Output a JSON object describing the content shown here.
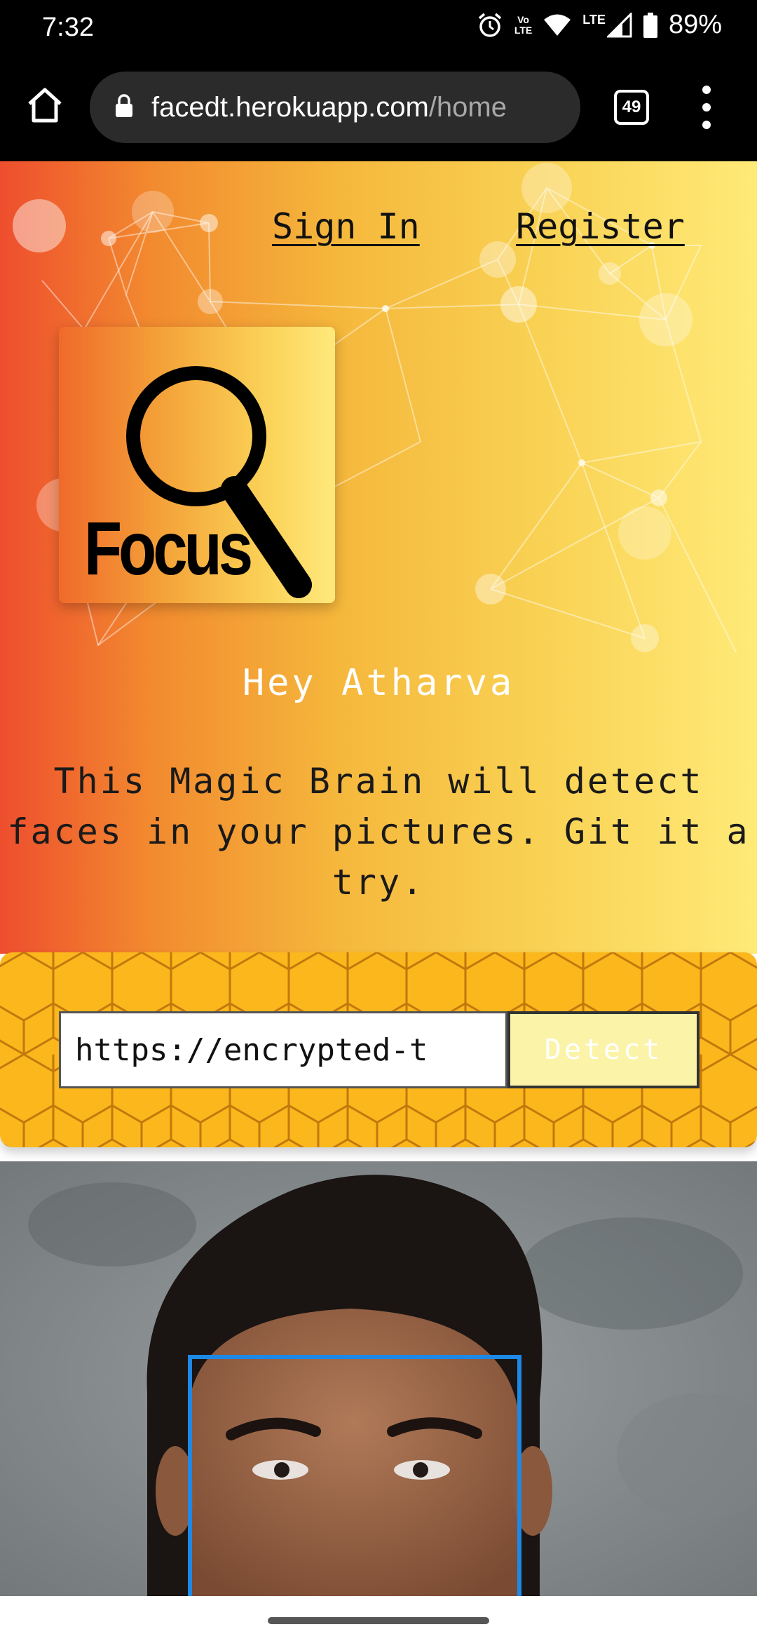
{
  "status_bar": {
    "time": "7:32",
    "volte_top": "Vo",
    "volte_bottom": "LTE",
    "lte": "LTE",
    "battery": "89%"
  },
  "browser": {
    "url_domain": "facedt.herokuapp.com",
    "url_path": "/home",
    "tab_count": "49"
  },
  "nav": {
    "sign_in": "Sign In",
    "register": "Register"
  },
  "logo": {
    "text": "Focus"
  },
  "hero": {
    "greeting": "Hey Atharva",
    "tagline": "This Magic Brain will detect faces in your pictures. Git it a try."
  },
  "detect_form": {
    "input_value": "https://encrypted-t",
    "button_label": "Detect"
  },
  "colors": {
    "face_box": "#1e88e5",
    "panel": "#fbb71c"
  }
}
